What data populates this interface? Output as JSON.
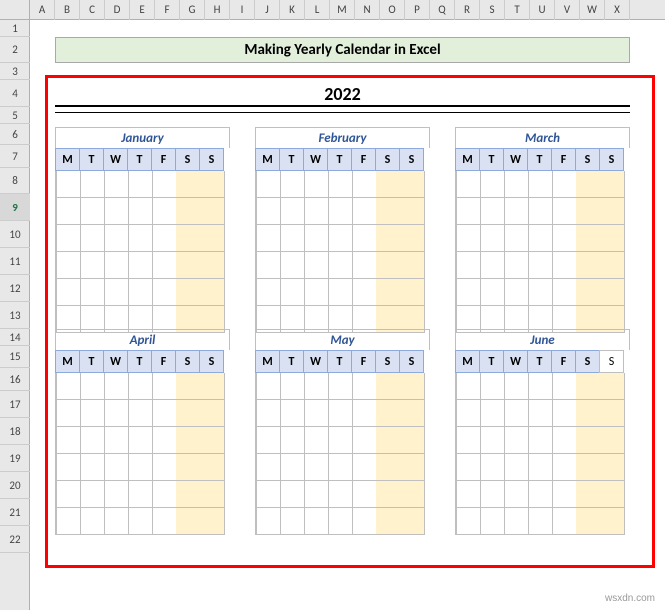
{
  "columns": [
    "A",
    "B",
    "C",
    "D",
    "E",
    "F",
    "G",
    "H",
    "I",
    "J",
    "K",
    "L",
    "M",
    "N",
    "O",
    "P",
    "Q",
    "R",
    "S",
    "T",
    "U",
    "V",
    "W",
    "X"
  ],
  "rows": [
    1,
    2,
    3,
    4,
    5,
    6,
    7,
    8,
    9,
    10,
    11,
    12,
    13,
    14,
    15,
    16,
    17,
    18,
    19,
    20,
    21,
    22
  ],
  "selected_row": 9,
  "title": "Making Yearly Calendar in Excel",
  "year": "2022",
  "dow": [
    "M",
    "T",
    "W",
    "T",
    "F",
    "S",
    "S"
  ],
  "months_row1": [
    "January",
    "February",
    "March"
  ],
  "months_row2": [
    "April",
    "May",
    "June"
  ],
  "watermark": "wsxdn.com"
}
